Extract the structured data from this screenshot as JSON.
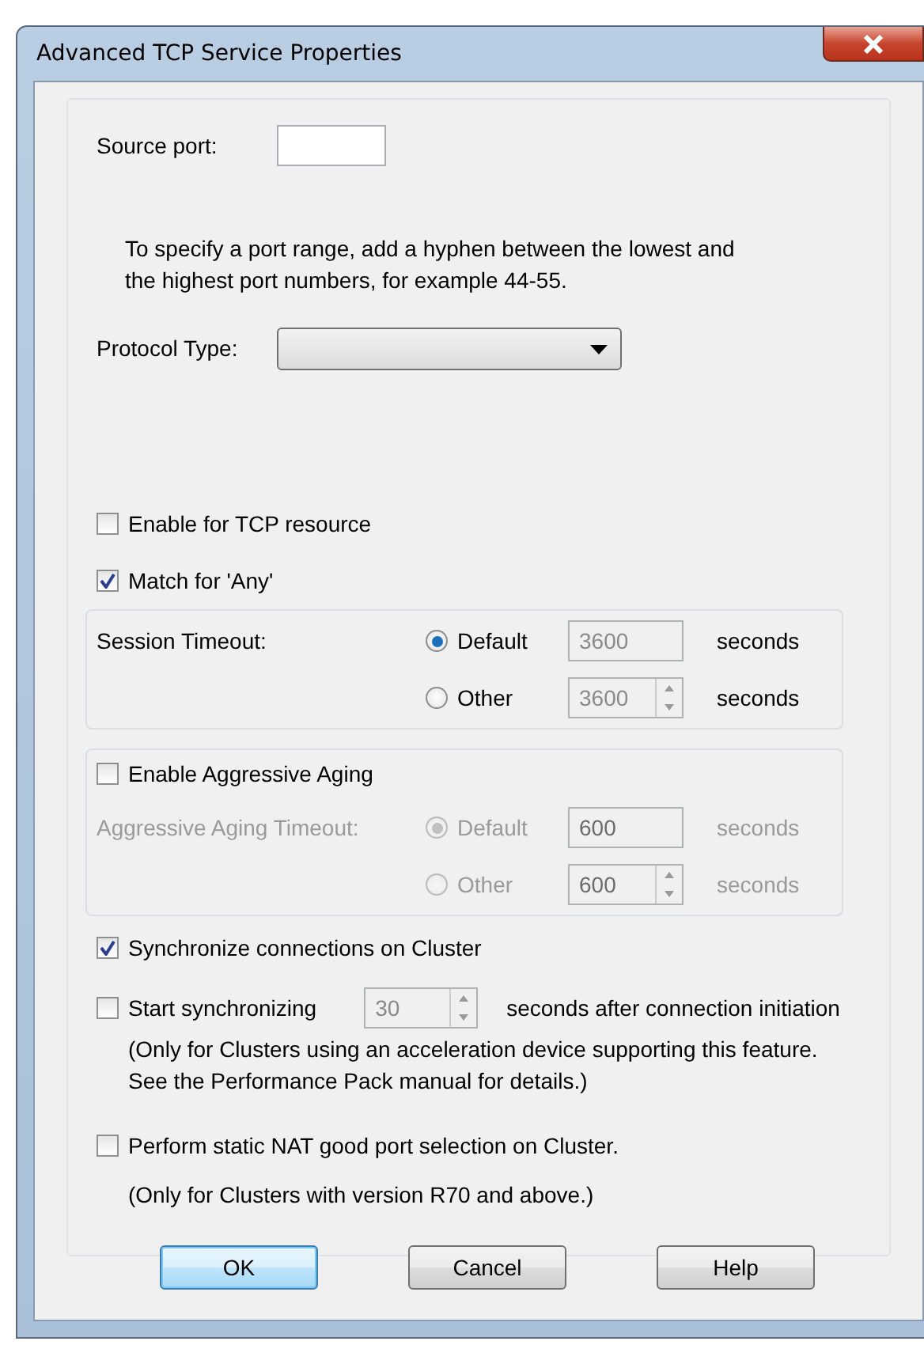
{
  "window": {
    "title": "Advanced TCP Service Properties"
  },
  "source_port": {
    "label": "Source port:"
  },
  "port_range_hint": "To specify a port range, add a hyphen between the lowest and\nthe highest port numbers, for example 44-55.",
  "protocol_type": {
    "label": "Protocol Type:"
  },
  "enable_tcp_resource": {
    "label": "Enable for TCP resource",
    "checked": false
  },
  "match_any": {
    "label": "Match for 'Any'",
    "checked": true
  },
  "session_timeout": {
    "label": "Session Timeout:",
    "disabled": false,
    "options": [
      {
        "label": "Default",
        "selected": true,
        "kind": "text",
        "value": "3600",
        "unit": "seconds"
      },
      {
        "label": "Other",
        "selected": false,
        "kind": "spinner",
        "value": "3600",
        "unit": "seconds"
      }
    ]
  },
  "aggressive_aging": {
    "checkbox": {
      "label": "Enable Aggressive Aging",
      "checked": false
    },
    "label": "Aggressive Aging Timeout:",
    "disabled": true,
    "options": [
      {
        "label": "Default",
        "selected": true,
        "kind": "text",
        "value": "600",
        "unit": "seconds"
      },
      {
        "label": "Other",
        "selected": false,
        "kind": "spinner",
        "value": "600",
        "unit": "seconds"
      }
    ]
  },
  "sync_cluster": {
    "label": "Synchronize connections on Cluster",
    "checked": true
  },
  "start_sync": {
    "label": "Start synchronizing",
    "checked": false,
    "value": "30",
    "suffix": "seconds after connection initiation",
    "note": "(Only for Clusters using an acceleration device supporting this feature.\nSee the Performance Pack manual for details.)"
  },
  "nat_selection": {
    "label": "Perform static NAT good port selection on Cluster.",
    "checked": false,
    "note": "(Only for Clusters with version R70 and above.)"
  },
  "buttons": [
    {
      "label": "OK",
      "default": true
    },
    {
      "label": "Cancel",
      "default": false
    },
    {
      "label": "Help",
      "default": false
    }
  ]
}
